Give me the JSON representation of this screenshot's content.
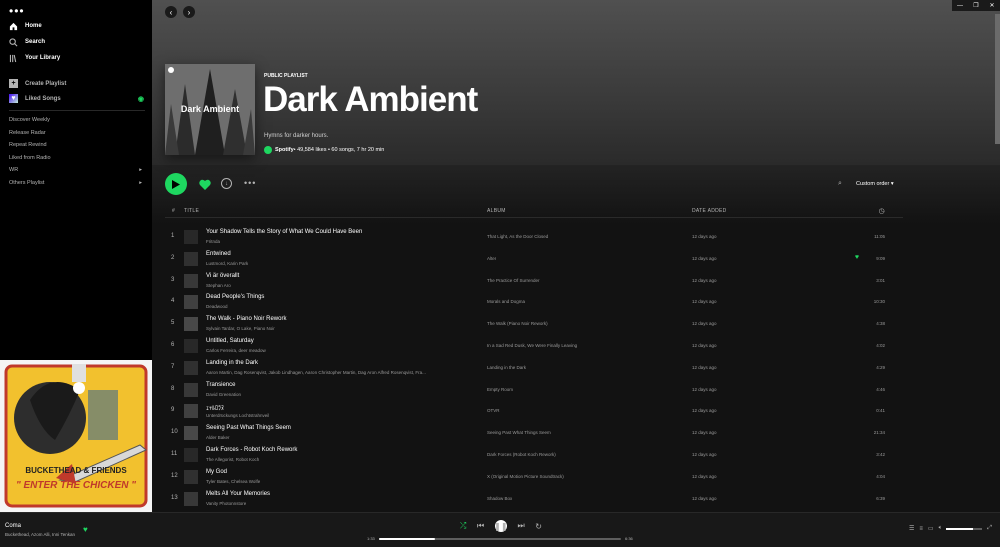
{
  "sidebar": {
    "nav": [
      {
        "label": "Home",
        "icon": "home-icon"
      },
      {
        "label": "Search",
        "icon": "search-icon"
      },
      {
        "label": "Your Library",
        "icon": "library-icon"
      }
    ],
    "create_playlist": "Create Playlist",
    "liked_songs": "Liked Songs",
    "playlists": [
      "Discover Weekly",
      "Release Radar",
      "Repeat Rewind",
      "Liked from Radio",
      "WR",
      "Others Playlist"
    ]
  },
  "playlist": {
    "type": "PUBLIC PLAYLIST",
    "title": "Dark Ambient",
    "cover_title": "Dark Ambient",
    "description": "Hymns for darker hours.",
    "owner": "Spotify",
    "stats": " • 49,584 likes • 60 songs, 7 hr 20 min",
    "sort": "Custom order"
  },
  "table": {
    "headers": {
      "num": "#",
      "title": "TITLE",
      "album": "ALBUM",
      "date": "DATE ADDED"
    },
    "rows": [
      {
        "n": "1",
        "title": "Your Shadow Tells the Story of What We Could Have Been",
        "artist": "Fritnda",
        "album": "That Light, As the Door Closed",
        "date": "12 days ago",
        "dur": "11:05",
        "liked": false
      },
      {
        "n": "2",
        "title": "Entwined",
        "artist": "Lustmord, Karin Park",
        "album": "Alter",
        "date": "12 days ago",
        "dur": "9:09",
        "liked": true
      },
      {
        "n": "3",
        "title": "Vi är överallt",
        "artist": "Stephan Aro",
        "album": "The Practice Of Surrender",
        "date": "12 days ago",
        "dur": "3:01",
        "liked": false
      },
      {
        "n": "4",
        "title": "Dead People's Things",
        "artist": "Deadwood",
        "album": "Morals and Dogma",
        "date": "12 days ago",
        "dur": "10:30",
        "liked": false
      },
      {
        "n": "5",
        "title": "The Walk - Piano Noir Rework",
        "artist": "Sylvain Tardar, O Lake, Piano Noir",
        "album": "The Walk (Piano Noir Rework)",
        "date": "12 days ago",
        "dur": "4:38",
        "liked": false
      },
      {
        "n": "6",
        "title": "Untitled, Saturday",
        "artist": "Carlos Ferreira, deer meadow",
        "album": "In a Sad Red Dusk, We Were Finally Leaving",
        "date": "12 days ago",
        "dur": "4:02",
        "liked": false
      },
      {
        "n": "7",
        "title": "Landing in the Dark",
        "artist": "Aaron Martin, Dag Rosenqvist, Jakob Lindhagen, Aaron Christopher Martin, Dag Aron Alfred Rosenqvist, Fra...",
        "album": "Landing in the Dark",
        "date": "12 days ago",
        "dur": "4:29",
        "liked": false
      },
      {
        "n": "8",
        "title": "Transience",
        "artist": "David Greenation",
        "album": "Empty Room",
        "date": "12 days ago",
        "dur": "4:46",
        "liked": false
      },
      {
        "n": "9",
        "title": "ｪｬﾙﾛﾗﾇ",
        "artist": "Unterdrückungs Lochtstrahnveil",
        "album": "OTVR",
        "date": "12 days ago",
        "dur": "0:41",
        "liked": false
      },
      {
        "n": "10",
        "title": "Seeing Past What Things Seem",
        "artist": "Alder Baker",
        "album": "Seeing Past What Things Seem",
        "date": "12 days ago",
        "dur": "21:34",
        "liked": false
      },
      {
        "n": "11",
        "title": "Dark Forces - Robot Koch Rework",
        "artist": "The Allegorist, Robot Koch",
        "album": "Dark Forces (Robot Koch Rework)",
        "date": "12 days ago",
        "dur": "3:42",
        "liked": false
      },
      {
        "n": "12",
        "title": "My God",
        "artist": "Tyler Bates, Chelsea Wolfe",
        "album": "X (Original Motion Picture Soundtrack)",
        "date": "12 days ago",
        "dur": "4:04",
        "liked": false
      },
      {
        "n": "13",
        "title": "Melts All Your Memories",
        "artist": "Vanity Photonnstore",
        "album": "Shadow Box",
        "date": "12 days ago",
        "dur": "6:39",
        "liked": false
      }
    ]
  },
  "now_playing": {
    "title": "Coma",
    "artist": "Buckethead, Azom Alli, Inni Tenkan",
    "time_current": "1:33",
    "time_total": "6:36",
    "progress": 0.23,
    "volume": 0.75
  },
  "album_art": {
    "line1": "BUCKETHEAD & FRIENDS",
    "line2": "\" ENTER THE CHICKEN \""
  },
  "colors": {
    "accent": "#1ed760",
    "bg": "#121212",
    "sidebar": "#000000"
  }
}
